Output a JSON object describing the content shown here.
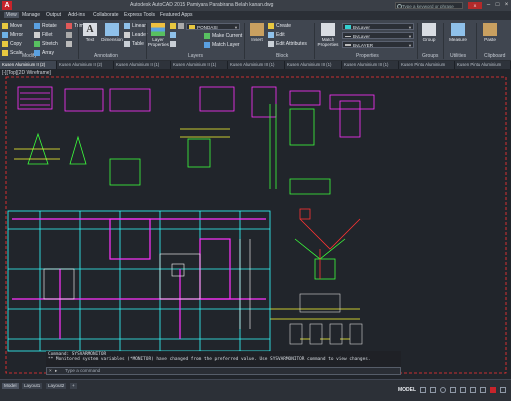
{
  "titlebar": {
    "logo": "A",
    "title": "Autodesk AutoCAD 2015   Pamiyara Parabirana Belah kanan.dwg",
    "search_placeholder": "Type a keyword or phrase",
    "exchange_label": "X",
    "min": "–",
    "max": "□",
    "close": "×"
  },
  "menubar": {
    "items": [
      "View",
      "Manage",
      "Output",
      "Add-ins",
      "Collaborate",
      "Express Tools",
      "Featured Apps"
    ]
  },
  "ribbon": {
    "modify": {
      "label": "Modify",
      "items": [
        "Move",
        "Rotate",
        "Trim",
        "Mirror",
        "Fillet",
        "Copy",
        "Stretch",
        "Scale",
        "Array"
      ]
    },
    "annotation": {
      "label": "Annotation",
      "big": "Text",
      "items": [
        "Dimension",
        "Linear",
        "Leader",
        "Table"
      ]
    },
    "layers": {
      "label": "Layers",
      "big": "Layer Properties",
      "layer_value": "PONDASI",
      "items": [
        "Make Current",
        "Match Layer"
      ]
    },
    "block": {
      "label": "Block",
      "big": "Insert",
      "items": [
        "Create",
        "Edit",
        "Edit Attributes"
      ]
    },
    "properties": {
      "label": "Properties",
      "big": "Match Properties",
      "color": "ByLayer",
      "linetype": "ByLayer",
      "lineweight": "ByLAYER"
    },
    "groups": {
      "label": "Groups",
      "big": "Group"
    },
    "utilities": {
      "label": "Utilities",
      "big": "Measure"
    },
    "clipboard": {
      "label": "Clipboard",
      "big": "Paste"
    }
  },
  "filetabs": {
    "tabs": [
      "Kusen Aluminium II (2)",
      "Kusen Aluminium II (2)",
      "Kusen Aluminium II (1)",
      "Kusen Aluminium II (1)",
      "Kusen Aluminium III (1)",
      "Kusen Aluminium III (1)",
      "Kusen Aluminium III (1)",
      "Kusen Pintu Aluminium",
      "Kusen Pintu Aluminium"
    ]
  },
  "canvas": {
    "viewport_label": "[-][Top][2D Wireframe]"
  },
  "command": {
    "history": [
      "Command: SYSVARMONITOR",
      "** Monitored system variables (*MONITOR) have changed from the preferred value. Use SYSVARMONITOR command to view changes."
    ],
    "placeholder": "Type a command",
    "close_glyph": "×",
    "prompt_glyph": "▸"
  },
  "statusbar": {
    "tabs": [
      "Model",
      "Layout1",
      "Layout2"
    ],
    "add_tab": "+",
    "model_label": "MODEL"
  },
  "colors": {
    "canvas": "#21252b",
    "ribbon": "#404650",
    "magenta": "#ff33ff",
    "green": "#3cff3c",
    "cyan": "#33ffff",
    "yellow": "#ffff33",
    "red": "#ff3333"
  }
}
